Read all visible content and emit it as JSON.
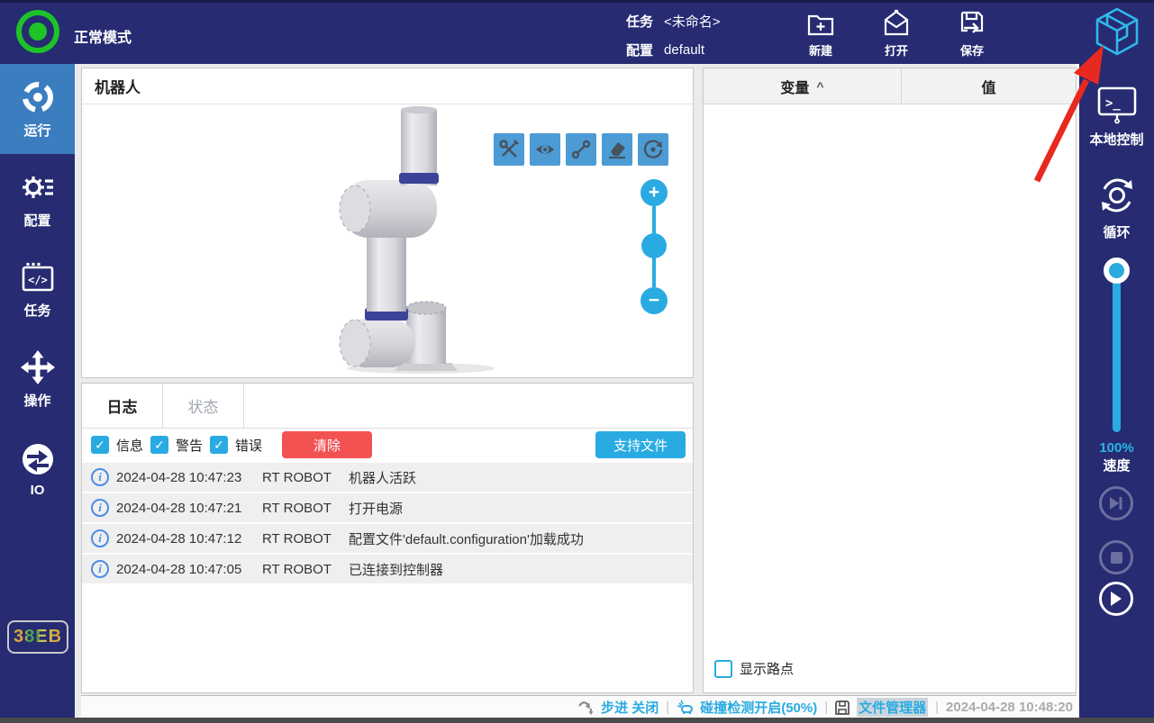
{
  "topbar": {
    "mode_label": "正常模式",
    "task_label": "任务",
    "task_value": "<未命名>",
    "config_label": "配置",
    "config_value": "default",
    "actions": [
      {
        "label": "新建"
      },
      {
        "label": "打开"
      },
      {
        "label": "保存"
      }
    ]
  },
  "sidebar": {
    "items": [
      {
        "label": "运行",
        "active": true
      },
      {
        "label": "配置",
        "active": false
      },
      {
        "label": "任务",
        "active": false
      },
      {
        "label": "操作",
        "active": false
      },
      {
        "label": "IO",
        "active": false
      }
    ],
    "badge": "38EB"
  },
  "robot_panel": {
    "title": "机器人"
  },
  "log_panel": {
    "tabs": [
      {
        "label": "日志",
        "active": true
      },
      {
        "label": "状态",
        "active": false
      }
    ],
    "filters": [
      {
        "label": "信息",
        "checked": true
      },
      {
        "label": "警告",
        "checked": true
      },
      {
        "label": "错误",
        "checked": true
      }
    ],
    "clear_label": "清除",
    "support_label": "支持文件",
    "entries": [
      {
        "time": "2024-04-28 10:47:23",
        "source": "RT ROBOT",
        "message": "机器人活跃"
      },
      {
        "time": "2024-04-28 10:47:21",
        "source": "RT ROBOT",
        "message": "打开电源"
      },
      {
        "time": "2024-04-28 10:47:12",
        "source": "RT ROBOT",
        "message": "配置文件'default.configuration'加载成功"
      },
      {
        "time": "2024-04-28 10:47:05",
        "source": "RT ROBOT",
        "message": "已连接到控制器"
      }
    ]
  },
  "variable_panel": {
    "col_variable": "变量",
    "col_value": "值",
    "show_waypoints": "显示路点",
    "show_waypoints_checked": false
  },
  "right_sidebar": {
    "local_control": "本地控制",
    "loop": "循环",
    "speed_value": "100%",
    "speed_label": "速度"
  },
  "statusbar": {
    "step": "步进 关闭",
    "collision": "碰撞检测开启(50%)",
    "file_manager": "文件管理器",
    "timestamp": "2024-04-28 10:48:20"
  },
  "icons": {
    "info": "i",
    "check": "✓",
    "caret_up": "^",
    "plus": "+",
    "minus": "−",
    "separator": "|",
    "code": "</>",
    "prompt": ">_"
  },
  "colors": {
    "navy": "#262B72",
    "active_nav": "#3B7EC0",
    "accent_cyan": "#29ABE2",
    "toolbar_blue": "#4D9BD5",
    "danger_red": "#F25252",
    "status_green": "#1DC327",
    "arrow_red": "#E8291F"
  }
}
